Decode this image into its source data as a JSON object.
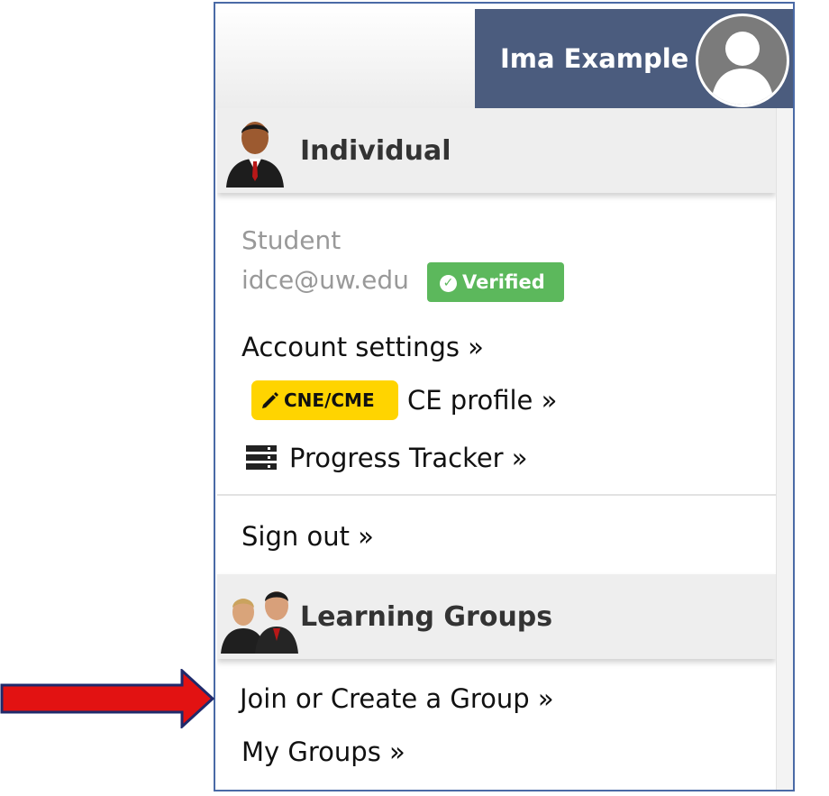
{
  "header": {
    "user_name": "Ima Example",
    "avatar_icon": "user-silhouette-icon"
  },
  "individual_section": {
    "title": "Individual",
    "icon": "businessman-icon",
    "role": "Student",
    "email": "idce@uw.edu",
    "verified_badge": "Verified",
    "verified_icon": "check-circle-icon",
    "account_settings": "Account settings »",
    "cne_badge": "CNE/CME",
    "cne_icon": "pencil-icon",
    "ce_profile": "CE profile »",
    "progress_tracker": "Progress Tracker »",
    "progress_icon": "list-icon",
    "sign_out": "Sign out »"
  },
  "groups_section": {
    "title": "Learning Groups",
    "icon": "group-people-icon",
    "join_create": "Join or Create a Group »",
    "my_groups": "My Groups »"
  },
  "annotation": {
    "arrow_icon": "red-arrow-icon",
    "arrow_color": "#e21212"
  },
  "colors": {
    "user_bar": "#4b5c7e",
    "verified": "#5cb85c",
    "cne_badge": "#ffd400",
    "frame_border": "#4a6aa6"
  }
}
